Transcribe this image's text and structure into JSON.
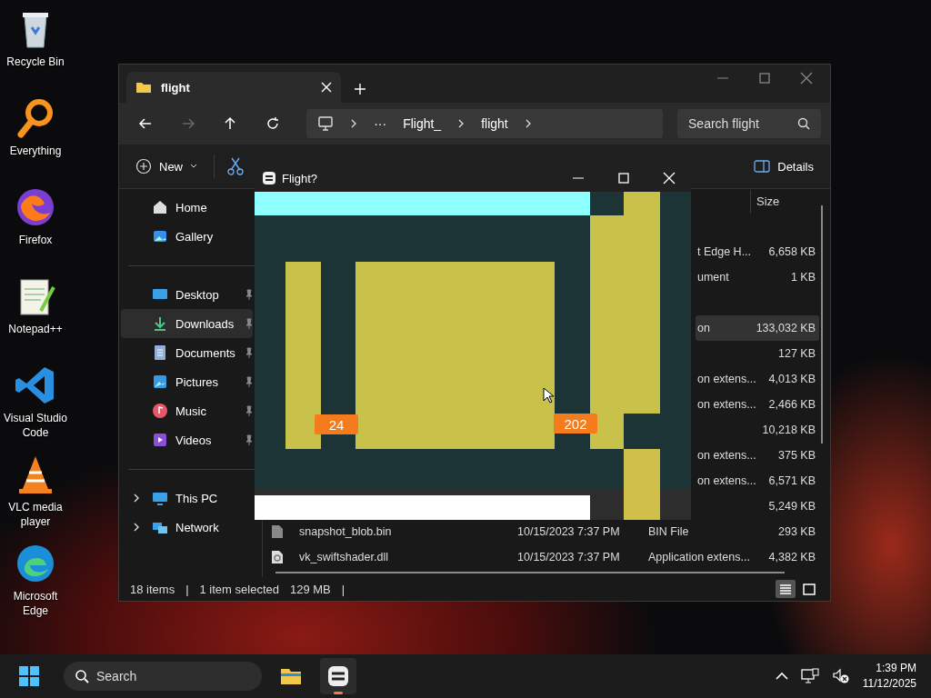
{
  "desktop_icons": [
    {
      "label": "Recycle Bin",
      "kind": "bin"
    },
    {
      "label": "Everything",
      "kind": "search"
    },
    {
      "label": "Firefox",
      "kind": "browser"
    },
    {
      "label": "Notepad++",
      "kind": "notepad"
    },
    {
      "label": "Visual Studio Code",
      "kind": "code"
    },
    {
      "label": "VLC media player",
      "kind": "cone"
    },
    {
      "label": "Microsoft Edge",
      "kind": "edge"
    }
  ],
  "explorer": {
    "tab": {
      "title": "flight"
    },
    "breadcrumb": {
      "overflow": "···",
      "parts": [
        "Flight_",
        "flight"
      ]
    },
    "search": {
      "placeholder": "Search flight"
    },
    "toolbar": {
      "new": "New",
      "details": "Details"
    },
    "sidebar": {
      "groups": [
        [
          {
            "label": "Home",
            "kind": "home",
            "pinned": false,
            "selected": false
          },
          {
            "label": "Gallery",
            "kind": "gallery",
            "pinned": false,
            "selected": false
          }
        ],
        [
          {
            "label": "Desktop",
            "kind": "desktop",
            "pinned": true,
            "selected": false
          },
          {
            "label": "Downloads",
            "kind": "downloads",
            "pinned": true,
            "selected": true
          },
          {
            "label": "Documents",
            "kind": "documents",
            "pinned": true,
            "selected": false
          },
          {
            "label": "Pictures",
            "kind": "pictures",
            "pinned": true,
            "selected": false
          },
          {
            "label": "Music",
            "kind": "music",
            "pinned": true,
            "selected": false
          },
          {
            "label": "Videos",
            "kind": "videos",
            "pinned": true,
            "selected": false
          }
        ],
        [
          {
            "label": "This PC",
            "kind": "pc",
            "pinned": false,
            "selected": false,
            "expanded": false
          },
          {
            "label": "Network",
            "kind": "network",
            "pinned": false,
            "selected": false,
            "expanded": false
          }
        ]
      ]
    },
    "columns": [
      "Size"
    ],
    "rows": [
      {},
      {
        "type": "t Edge H...",
        "size": "6,658 KB",
        "selected": false
      },
      {
        "type": "ument",
        "size": "1 KB",
        "selected": false
      },
      {},
      {
        "type": "on",
        "size": "133,032 KB",
        "selected": true
      },
      {
        "size": "127 KB",
        "selected": false
      },
      {
        "type": "on extens...",
        "size": "4,013 KB",
        "selected": false
      },
      {
        "type": "on extens...",
        "size": "2,466 KB",
        "selected": false
      },
      {
        "size": "10,218 KB",
        "selected": false
      },
      {
        "type": "on extens...",
        "size": "375 KB",
        "selected": false
      },
      {
        "type": "on extens...",
        "size": "6,571 KB",
        "selected": false
      },
      {
        "size": "5,249 KB",
        "selected": false
      },
      {
        "kind": "file",
        "name": "snapshot_blob.bin",
        "date": "10/15/2023 7:37 PM",
        "type": "BIN File",
        "size": "293 KB",
        "selected": false
      },
      {
        "kind": "dll",
        "name": "vk_swiftshader.dll",
        "date": "10/15/2023 7:37 PM",
        "type": "Application extens...",
        "size": "4,382 KB",
        "selected": false
      }
    ],
    "status_bar": {
      "items": "18 items",
      "selection": "1 item selected",
      "size": "129 MB",
      "separator": "|"
    },
    "views": [
      {
        "kind": "details",
        "selected": true
      },
      {
        "kind": "tiles",
        "selected": false
      }
    ]
  },
  "game": {
    "title": "Flight?",
    "scores": [
      "24",
      "202"
    ]
  },
  "taskbar": {
    "search": {
      "placeholder": "Search"
    },
    "apps": [
      {
        "kind": "explorer",
        "active": false
      },
      {
        "kind": "game",
        "active": true
      }
    ],
    "time": "1:39 PM",
    "date": "11/12/2025"
  }
}
